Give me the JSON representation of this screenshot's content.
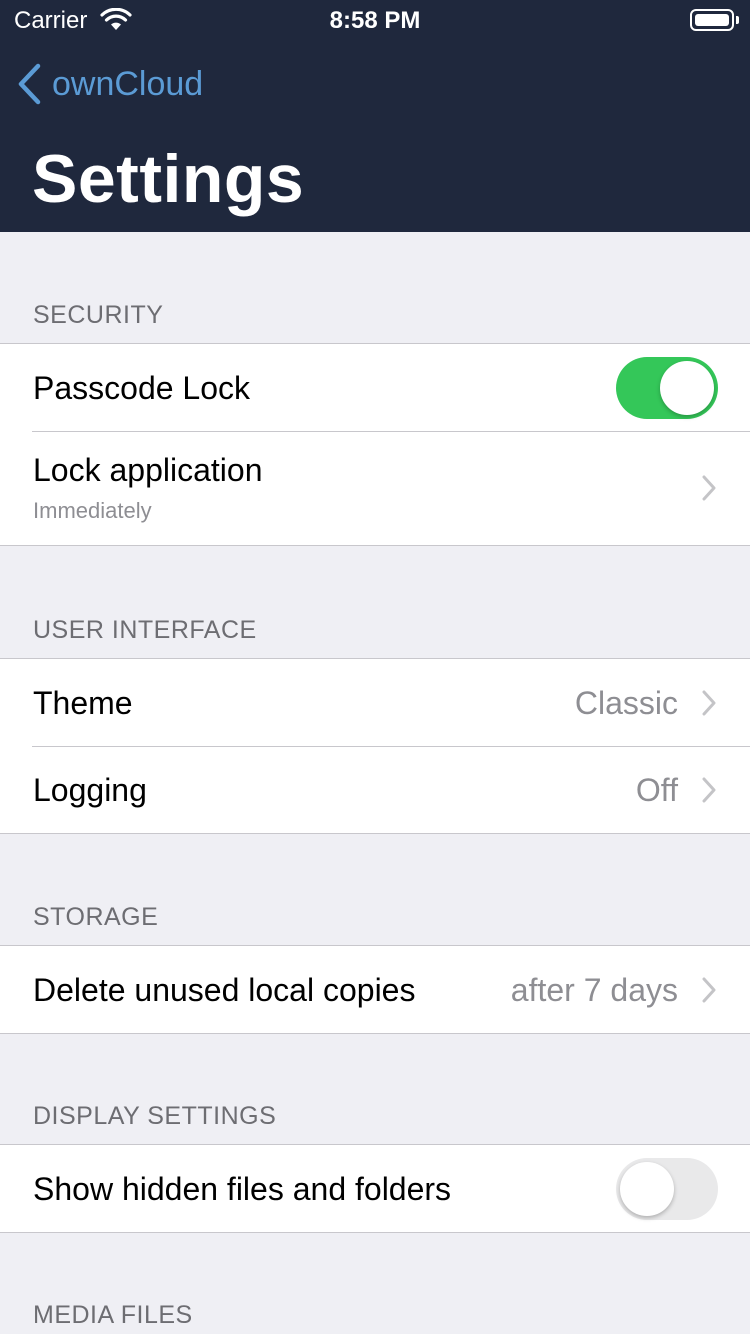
{
  "status_bar": {
    "carrier": "Carrier",
    "time": "8:58 PM"
  },
  "nav": {
    "back_label": "ownCloud",
    "title": "Settings"
  },
  "sections": {
    "security": {
      "header": "SECURITY",
      "passcode_lock": {
        "label": "Passcode Lock",
        "enabled": true
      },
      "lock_application": {
        "label": "Lock application",
        "subtitle": "Immediately"
      }
    },
    "user_interface": {
      "header": "USER INTERFACE",
      "theme": {
        "label": "Theme",
        "value": "Classic"
      },
      "logging": {
        "label": "Logging",
        "value": "Off"
      }
    },
    "storage": {
      "header": "STORAGE",
      "delete_copies": {
        "label": "Delete unused local copies",
        "value": "after 7 days"
      }
    },
    "display_settings": {
      "header": "DISPLAY SETTINGS",
      "show_hidden": {
        "label": "Show hidden files and folders",
        "enabled": false
      }
    },
    "media_files": {
      "header": "MEDIA FILES"
    }
  },
  "colors": {
    "nav_background": "#1f283d",
    "accent": "#5b9bd5",
    "toggle_on": "#34c759"
  },
  "icons": [
    "wifi-icon",
    "battery-icon",
    "back-chevron-icon",
    "chevron-right-icon"
  ]
}
